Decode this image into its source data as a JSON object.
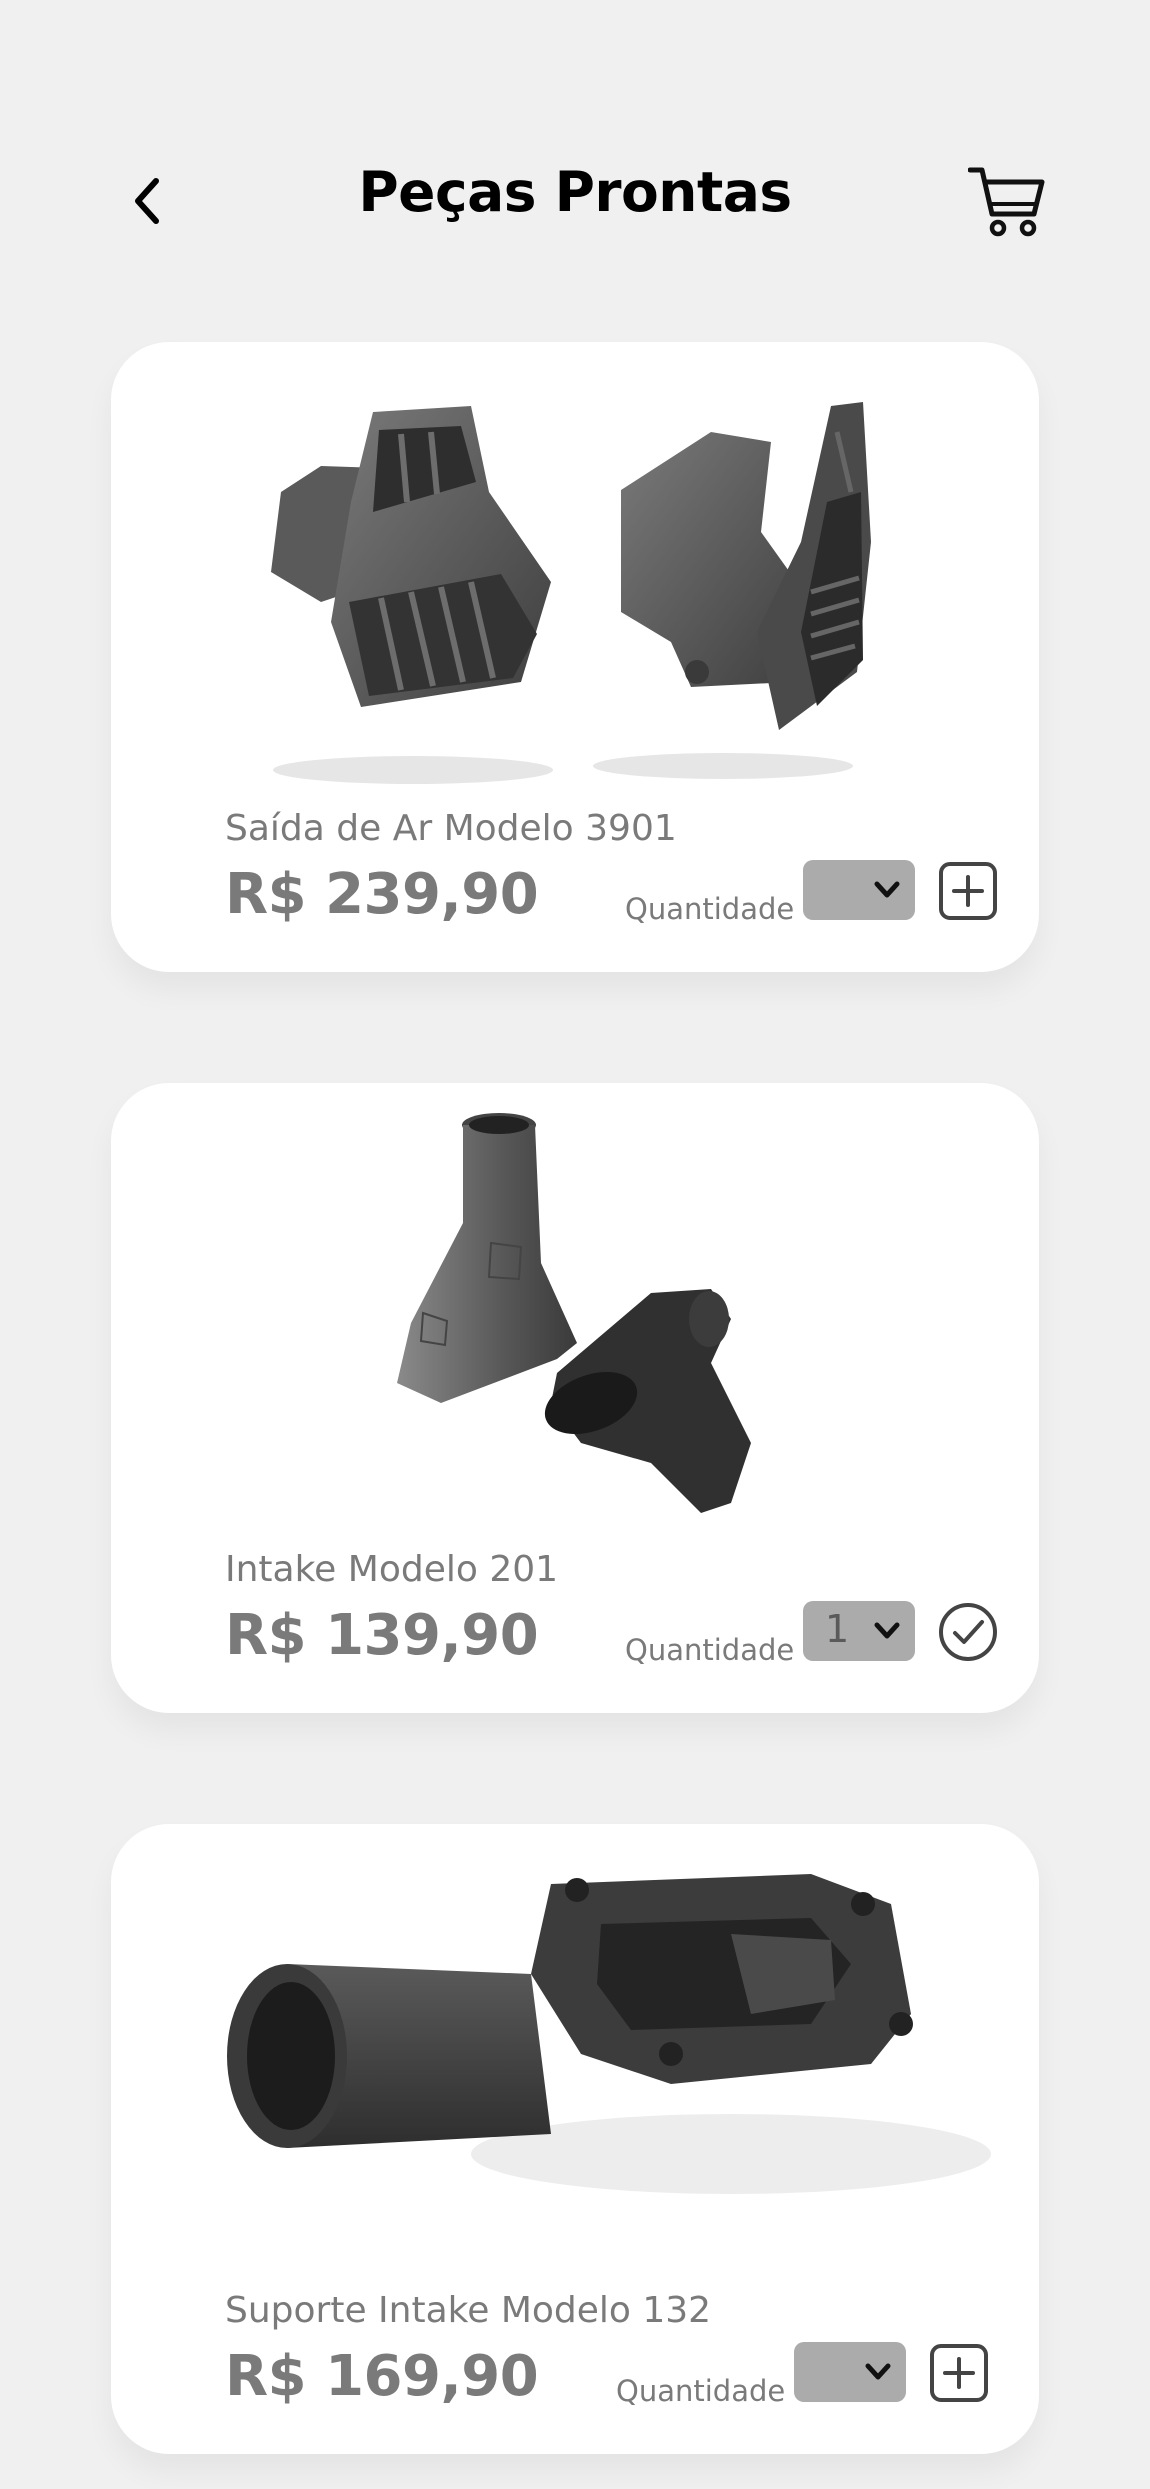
{
  "header": {
    "title": "Peças Prontas",
    "back_icon": "chevron-left-icon",
    "cart_icon": "cart-icon"
  },
  "products": [
    {
      "name": "Saída de Ar Modelo 3901",
      "price": "R$ 239,90",
      "quantity_label": "Quantidade",
      "quantity_value": "",
      "action_icon": "plus-square-icon"
    },
    {
      "name": "Intake Modelo 201",
      "price": "R$ 139,90",
      "quantity_label": "Quantidade",
      "quantity_value": "1",
      "action_icon": "check-circle-icon"
    },
    {
      "name": "Suporte Intake Modelo 132",
      "price": "R$ 169,90",
      "quantity_label": "Quantidade",
      "quantity_value": "",
      "action_icon": "plus-square-icon"
    }
  ],
  "colors": {
    "background": "#f0f0f0",
    "card": "#ffffff",
    "text_muted": "#7a7a7a",
    "select_bg": "#ababab",
    "title": "#000000"
  }
}
